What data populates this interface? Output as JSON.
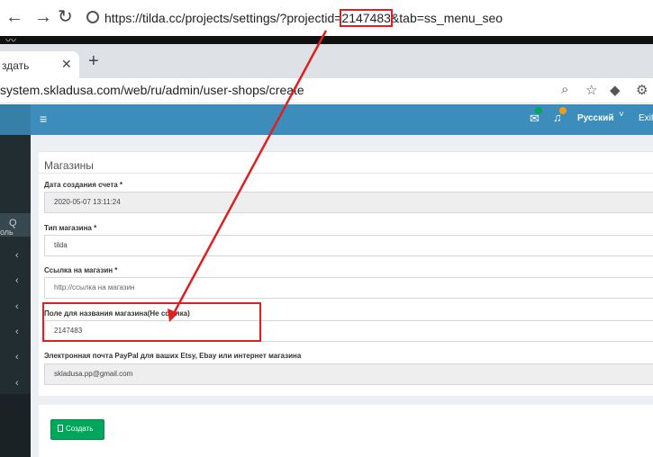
{
  "browser_top": {
    "url_prefix": "https://tilda.cc/projects/settings/?projectid=",
    "url_project_id": "2147483",
    "url_suffix": "&tab=ss_menu_seo"
  },
  "browser": {
    "tab_title": "здать",
    "url": "system.skladusa.com/web/ru/admin/user-shops/create"
  },
  "header": {
    "menu_icon": "hamburger-icon",
    "language": "Русский",
    "exit": "Exit"
  },
  "sidebar": {
    "label": "оль"
  },
  "panel": {
    "title": "Магазины",
    "fields": [
      {
        "label": "Дата создания счета *",
        "value": "2020-05-07 13:11:24"
      },
      {
        "label": "Тип магазина *",
        "value": "tilda"
      },
      {
        "label": "Ссылка на магазин *",
        "placeholder": "http://ссылка на магазин"
      },
      {
        "label": "Поле для названия магазина(Не ссылка)",
        "value": "2147483"
      },
      {
        "label": "Электронная почта PayPal для ваших Etsy, Ebay или интернет магазина",
        "value": "skladusa.pp@gmail.com"
      }
    ]
  },
  "actions": {
    "create": "Создать"
  },
  "colors": {
    "header": "#3c8dbc",
    "sidebar": "#222d32",
    "button": "#00a65a",
    "annotation": "#e02020"
  }
}
